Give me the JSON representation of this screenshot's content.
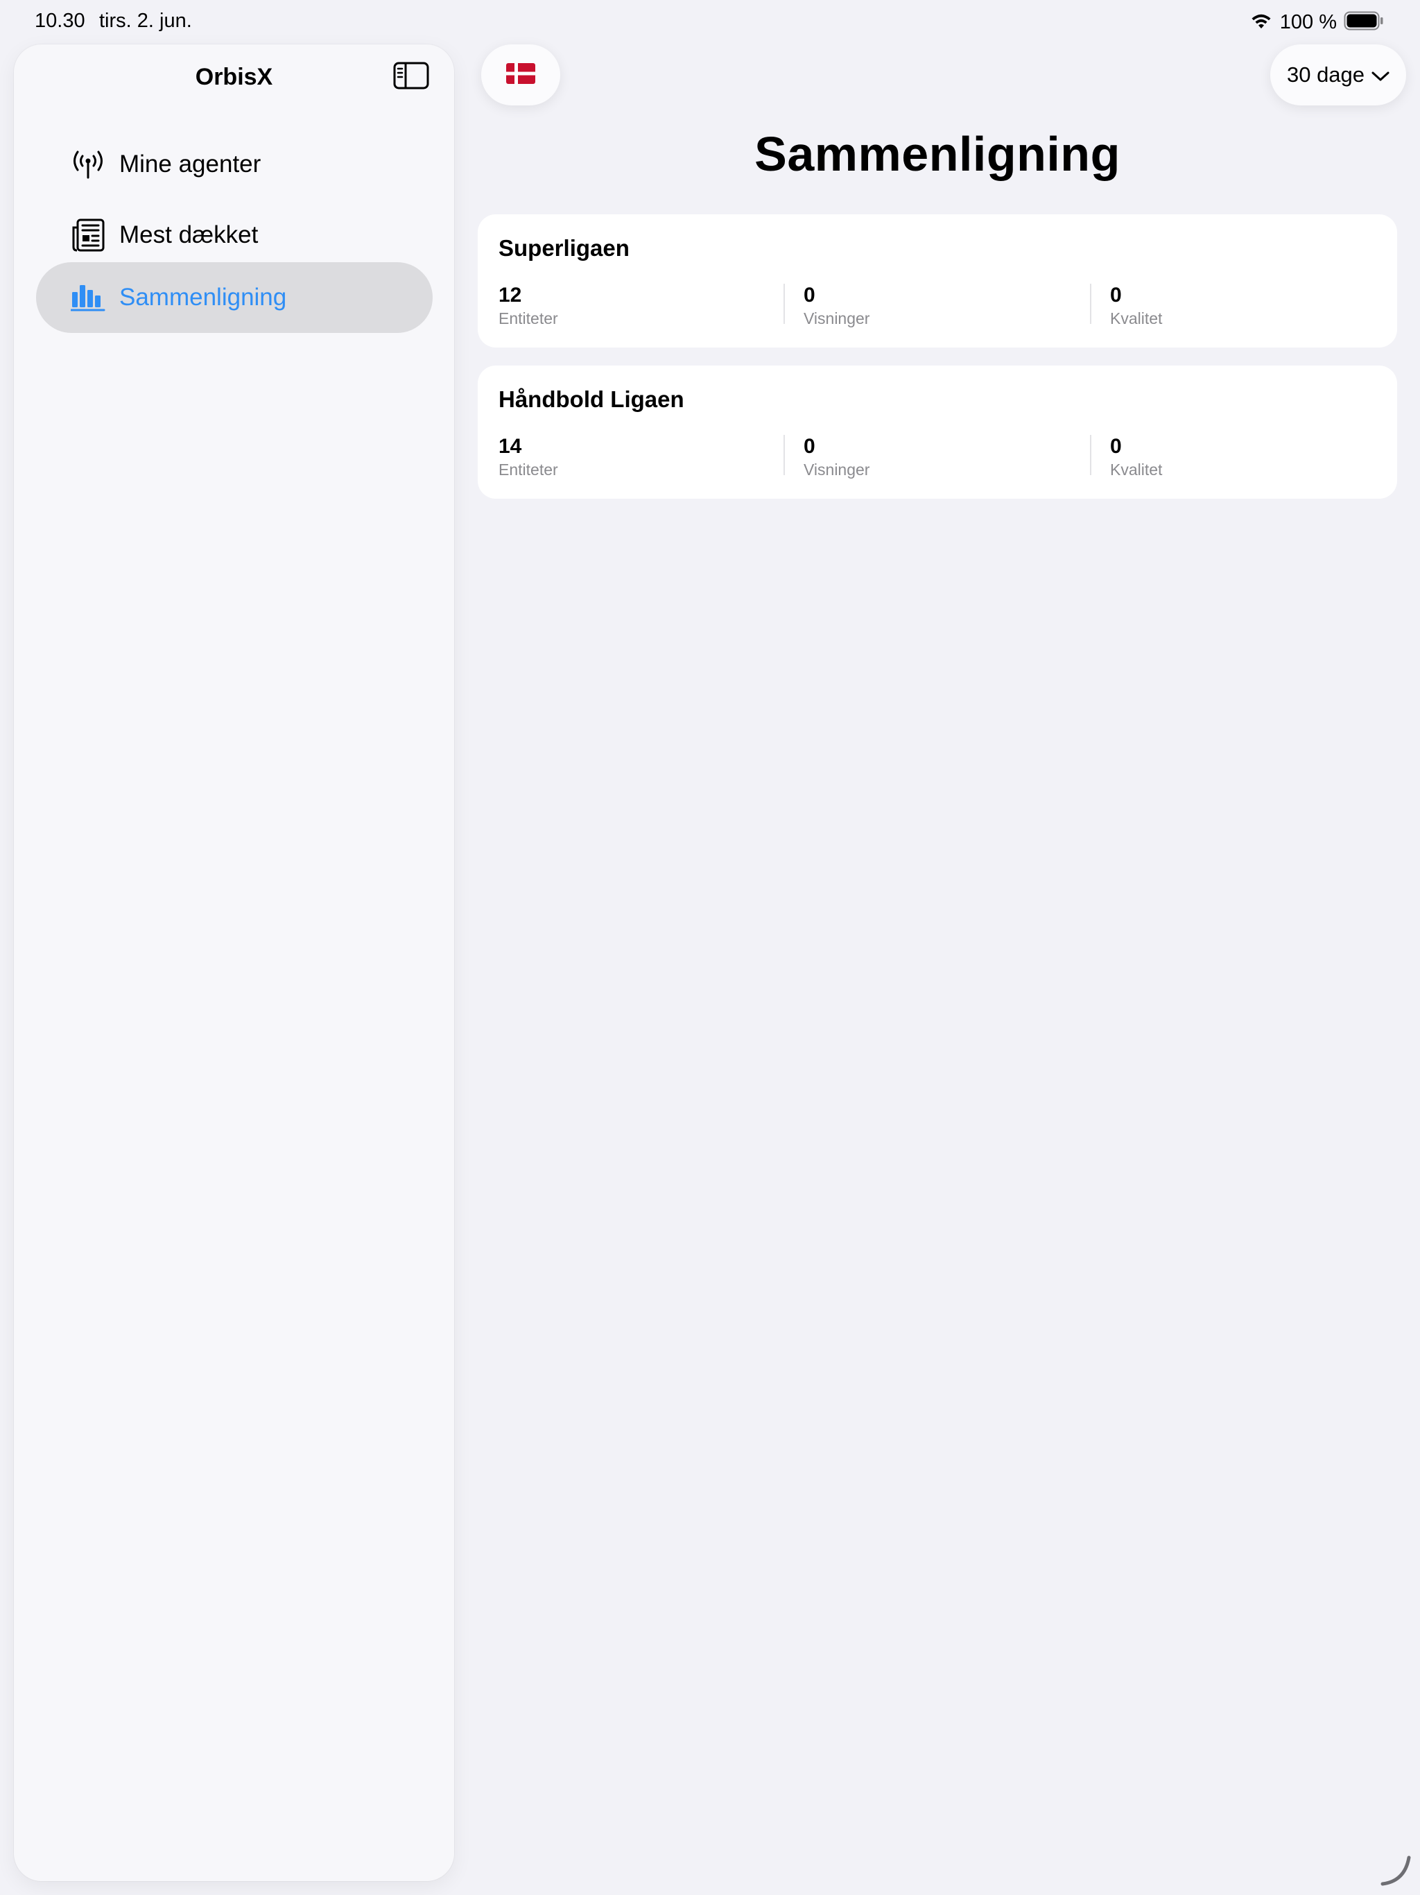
{
  "status_bar": {
    "time": "10.30",
    "date": "tirs. 2. jun.",
    "battery": "100 %"
  },
  "sidebar": {
    "title": "OrbisX",
    "toggle_icon": "sidebar-toggle-icon",
    "items": [
      {
        "label": "Mine agenter",
        "icon": "antenna-icon",
        "active": false
      },
      {
        "label": "Mest dækket",
        "icon": "newspaper-icon",
        "active": false
      },
      {
        "label": "Sammenligning",
        "icon": "bar-chart-icon",
        "active": true
      }
    ]
  },
  "toolbar": {
    "flag_icon": "denmark-flag-icon",
    "period_label": "30 dage"
  },
  "main": {
    "title": "Sammenligning",
    "cards": [
      {
        "title": "Superligaen",
        "metrics": [
          {
            "value": "12",
            "label": "Entiteter"
          },
          {
            "value": "0",
            "label": "Visninger"
          },
          {
            "value": "0",
            "label": "Kvalitet"
          }
        ]
      },
      {
        "title": "Håndbold Ligaen",
        "metrics": [
          {
            "value": "14",
            "label": "Entiteter"
          },
          {
            "value": "0",
            "label": "Visninger"
          },
          {
            "value": "0",
            "label": "Kvalitet"
          }
        ]
      }
    ]
  },
  "colors": {
    "accent": "#2f8ef5",
    "background": "#f2f2f7",
    "sidebar": "#f7f7fa",
    "active_item": "#dcdcdf",
    "flag_red": "#c8102e"
  }
}
